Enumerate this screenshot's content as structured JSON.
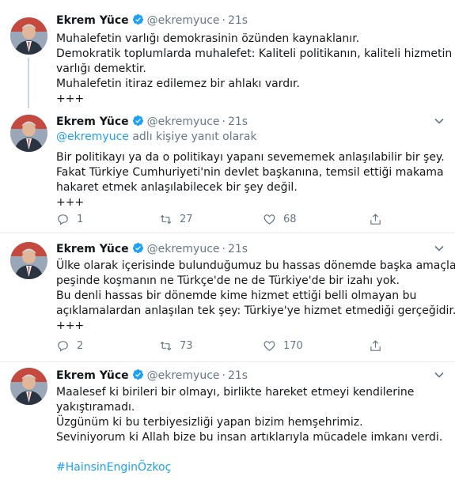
{
  "author": {
    "name": "Ekrem Yüce",
    "handle": "@ekremyuce",
    "separator": "·",
    "time": "21s"
  },
  "colors": {
    "link": "#1da1f2",
    "muted": "#657786",
    "verified": "#1da1f2"
  },
  "tweets": [
    {
      "lines": [
        "Muhalefetin varlığı demokrasinin özünden kaynaklanır.",
        "Demokratik toplumlarda muhalefet: Kaliteli politikanın, kaliteli hizmetin",
        "varlığı demektir.",
        "Muhalefetin itiraz edilemez bir ahlakı vardır.",
        "+++"
      ]
    },
    {
      "reply_handle": "@ekremyuce",
      "reply_suffix": " adlı kişiye yanıt olarak",
      "lines": [
        "Bir politikayı ya da o politikayı yapanı sevememek anlaşılabilir bir şey.",
        "Fakat Türkiye Cumhuriyeti'nin devlet başkanına, temsil ettiği makama",
        "hakaret etmek anlaşılabilecek bir şey değil.",
        "+++"
      ],
      "replies": "1",
      "retweets": "27",
      "likes": "68"
    },
    {
      "lines": [
        "Ülke olarak içerisinde bulunduğumuz bu hassas dönemde başka amaçların",
        "peşinde koşmanın ne Türkçe'de ne de Türkiye'de bir izahı yok.",
        "Bu denli hassas bir dönemde kime hizmet ettiği belli olmayan bu",
        "açıklamalardan anlaşılan tek şey: Türkiye'ye hizmet etmediği gerçeğidir.",
        "+++"
      ],
      "replies": "2",
      "retweets": "73",
      "likes": "170"
    },
    {
      "lines": [
        "Maalesef ki birileri bir olmayı, birlikte hareket etmeyi kendilerine",
        "yakıştıramadı.",
        "Üzgünüm ki bu terbiyesizliği yapan bizim hemşehrimiz.",
        "Seviniyorum ki Allah bize bu insan artıklarıyla mücadele imkanı verdi."
      ],
      "hashtag": "#HainsinEnginÖzkoç"
    }
  ]
}
